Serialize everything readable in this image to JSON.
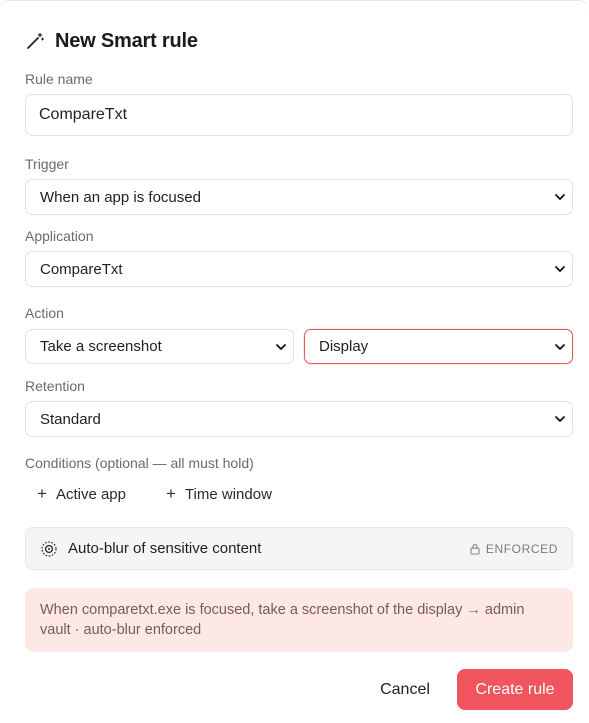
{
  "dialog": {
    "title": "New Smart rule",
    "title_icon": "magic-wand-icon"
  },
  "form": {
    "rule_name": {
      "label": "Rule name",
      "value": "CompareTxt"
    },
    "trigger": {
      "label": "Trigger",
      "value": "When an app is focused"
    },
    "application": {
      "label": "Application",
      "value": "CompareTxt"
    },
    "action": {
      "label": "Action",
      "value": "Take a screenshot",
      "target_value": "Display"
    },
    "retention": {
      "label": "Retention",
      "value": "Standard"
    }
  },
  "conditions": {
    "label": "Conditions (optional — all must hold)",
    "buttons": [
      "Active app",
      "Time window"
    ]
  },
  "enforced": {
    "label": "Auto-blur of sensitive content",
    "badge": "ENFORCED",
    "icon": "blur-icon",
    "badge_icon": "lock-icon"
  },
  "summary": "When comparetxt.exe is focused, take a screenshot of the display → admin vault · auto-blur enforced",
  "footer": {
    "cancel_label": "Cancel",
    "create_label": "Create rule"
  },
  "colors": {
    "accent": "#f0545c",
    "summary_bg": "#fde8e6",
    "focus_border": "#e05a5a"
  }
}
